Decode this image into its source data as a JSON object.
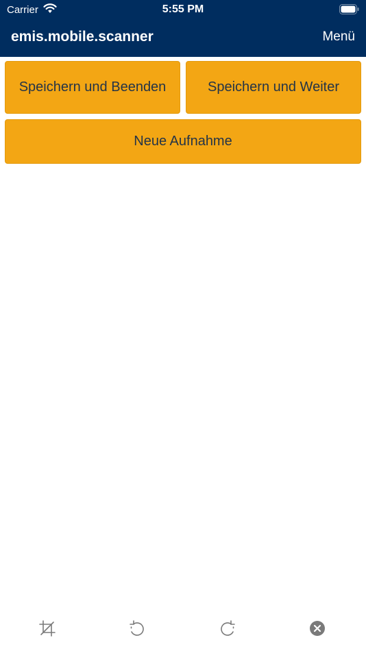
{
  "status_bar": {
    "carrier": "Carrier",
    "time": "5:55 PM",
    "wifi_icon": "wifi-icon",
    "battery_icon": "battery-icon"
  },
  "nav": {
    "title": "emis.mobile.scanner",
    "menu_label": "Menü"
  },
  "actions": {
    "save_and_finish": "Speichern und Beenden",
    "save_and_continue": "Speichern und Weiter",
    "new_capture": "Neue Aufnahme"
  },
  "toolbar": {
    "icons": [
      "crop-icon",
      "rotate-left-icon",
      "rotate-right-icon",
      "close-circle-icon"
    ]
  },
  "colors": {
    "nav_background": "#002d5f",
    "button_background": "#f3a614",
    "button_text": "#243447",
    "toolbar_icon": "#7a7a7a"
  }
}
